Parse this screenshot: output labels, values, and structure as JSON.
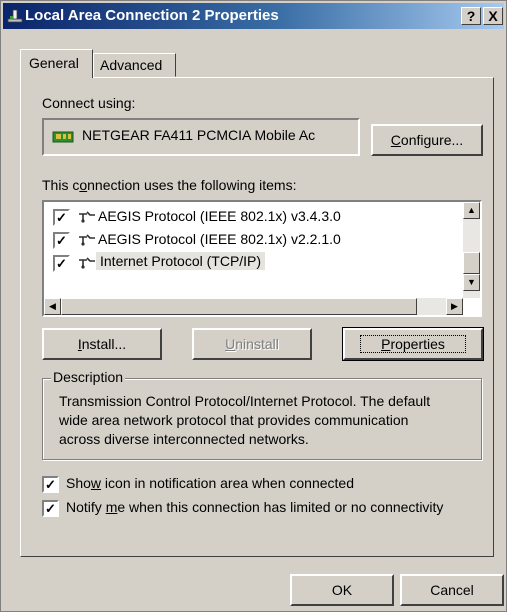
{
  "window": {
    "title": "Local Area Connection 2 Properties",
    "help_button": "?",
    "close_button": "X"
  },
  "tabs": [
    {
      "label": "General",
      "selected": true
    },
    {
      "label": "Advanced",
      "selected": false
    }
  ],
  "connect_using": {
    "label": "Connect using:",
    "adapter_name": "NETGEAR FA411 PCMCIA Mobile Ac",
    "configure_button": "Configure..."
  },
  "items_section": {
    "label": "This connection uses the following items:",
    "items": [
      {
        "label": "AEGIS Protocol (IEEE 802.1x) v3.4.3.0",
        "checked": true,
        "selected": false
      },
      {
        "label": "AEGIS Protocol (IEEE 802.1x) v2.2.1.0",
        "checked": true,
        "selected": false
      },
      {
        "label": "Internet Protocol (TCP/IP)",
        "checked": true,
        "selected": true
      }
    ]
  },
  "buttons": {
    "install": "Install...",
    "uninstall": "Uninstall",
    "properties": "Properties",
    "ok": "OK",
    "cancel": "Cancel"
  },
  "description": {
    "legend": "Description",
    "lines": [
      "Transmission Control Protocol/Internet Protocol. The default",
      "wide area network protocol that provides communication",
      "across diverse interconnected networks."
    ]
  },
  "options": [
    {
      "label": "Show icon in notification area when connected",
      "checked": true
    },
    {
      "label": "Notify me when this connection has limited or no connectivity",
      "checked": true
    }
  ],
  "colors": {
    "dialog_face": "#d4d0c8",
    "title_gradient_start": "#0a246a",
    "title_gradient_end": "#a6caf0",
    "selection_highlight": "#e5e3de"
  }
}
